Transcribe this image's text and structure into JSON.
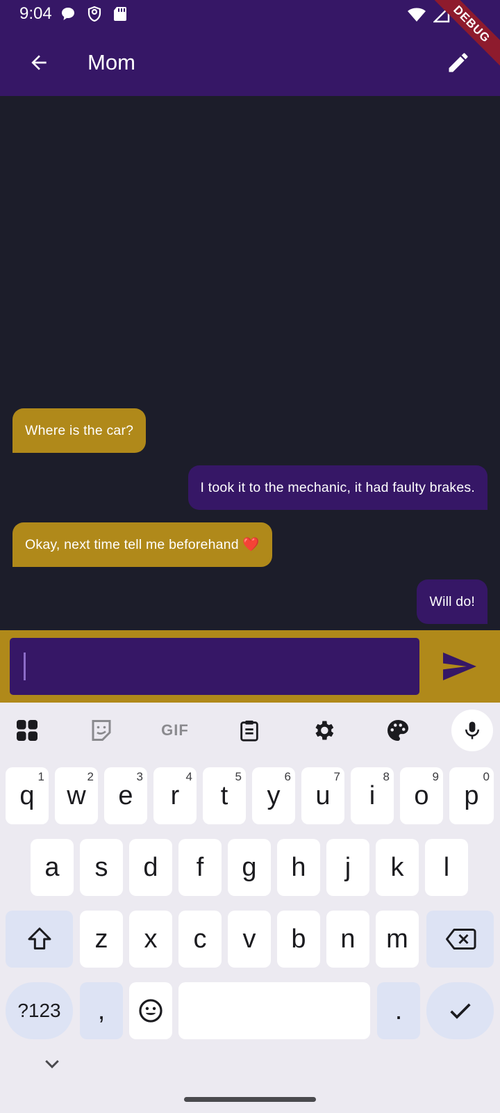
{
  "status_bar": {
    "time": "9:04",
    "debug_label": "DEBUG"
  },
  "app_bar": {
    "title": "Mom"
  },
  "messages": [
    {
      "text": "Where is the car?",
      "direction": "incoming"
    },
    {
      "text": "I took it to the mechanic, it had faulty brakes.",
      "direction": "outgoing"
    },
    {
      "text": "Okay, next time tell me beforehand ❤️",
      "direction": "incoming"
    },
    {
      "text": "Will do!",
      "direction": "outgoing"
    }
  ],
  "composer": {
    "value": "",
    "placeholder": ""
  },
  "keyboard": {
    "toolbar": {
      "gif_label": "GIF"
    },
    "row1": [
      {
        "letter": "q",
        "hint": "1"
      },
      {
        "letter": "w",
        "hint": "2"
      },
      {
        "letter": "e",
        "hint": "3"
      },
      {
        "letter": "r",
        "hint": "4"
      },
      {
        "letter": "t",
        "hint": "5"
      },
      {
        "letter": "y",
        "hint": "6"
      },
      {
        "letter": "u",
        "hint": "7"
      },
      {
        "letter": "i",
        "hint": "8"
      },
      {
        "letter": "o",
        "hint": "9"
      },
      {
        "letter": "p",
        "hint": "0"
      }
    ],
    "row2": [
      "a",
      "s",
      "d",
      "f",
      "g",
      "h",
      "j",
      "k",
      "l"
    ],
    "row3": [
      "z",
      "x",
      "c",
      "v",
      "b",
      "n",
      "m"
    ],
    "symbols_label": "?123",
    "comma": ",",
    "period": "."
  },
  "colors": {
    "app_bar": "#361766",
    "chat_background": "#1c1d2a",
    "incoming_bubble": "#b0891a",
    "outgoing_bubble": "#361766",
    "composer_bar": "#b0891a",
    "keyboard_background": "#eceaf1",
    "key_dark": "#dde3f4"
  }
}
